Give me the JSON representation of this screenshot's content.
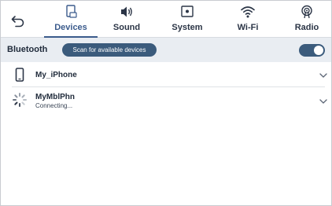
{
  "header": {
    "back_icon": "back-arrow-icon",
    "tabs": [
      {
        "label": "Devices",
        "icon": "phone-device-icon",
        "active": true
      },
      {
        "label": "Sound",
        "icon": "speaker-icon",
        "active": false
      },
      {
        "label": "System",
        "icon": "system-icon",
        "active": false
      },
      {
        "label": "Wi-Fi",
        "icon": "wifi-icon",
        "active": false
      },
      {
        "label": "Radio",
        "icon": "radio-antenna-icon",
        "active": false
      }
    ]
  },
  "bluetooth": {
    "label": "Bluetooth",
    "scan_button": "Scan for available devices",
    "enabled": true
  },
  "devices": [
    {
      "name": "My_iPhone",
      "status": "",
      "icon": "phone-icon"
    },
    {
      "name": "MyMblPhn",
      "status": "Connecting...",
      "icon": "loading-spinner-icon"
    }
  ],
  "colors": {
    "accent": "#3b5b8c",
    "button": "#3b5b7c",
    "bar": "#e9edf2"
  }
}
